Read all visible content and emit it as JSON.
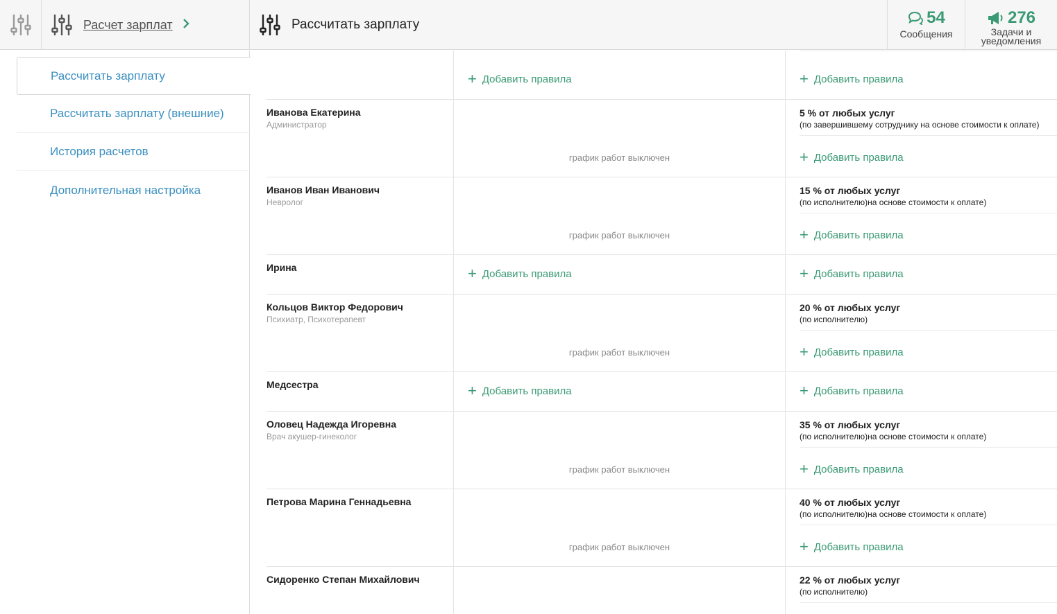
{
  "header": {
    "breadcrumb_link": "Расчет зарплат",
    "page_title": "Рассчитать зарплату",
    "messages": {
      "count": "54",
      "label": "Сообщения"
    },
    "tasks": {
      "count": "276",
      "label_line1": "Задачи и",
      "label_line2": "уведомления"
    }
  },
  "sidebar": {
    "items": [
      {
        "label": "Рассчитать зарплату"
      },
      {
        "label": "Рассчитать зарплату (внешние)"
      },
      {
        "label": "История расчетов"
      },
      {
        "label": "Дополнительная настройка"
      }
    ]
  },
  "table": {
    "add_rules_label": "Добавить правила",
    "schedule_off_label": "график работ выключен",
    "employees": [
      {
        "name": "Иванова Екатерина",
        "role": "Администратор",
        "rule": "5 % от любых услуг",
        "rule_desc": "(по завершившему сотруднику на основе стоимости к оплате)"
      },
      {
        "name": "Иванов Иван Иванович",
        "role": "Невролог",
        "rule": "15 % от любых услуг",
        "rule_desc": "(по исполнителю)на основе стоимости к оплате)"
      },
      {
        "name": "Ирина",
        "role": ""
      },
      {
        "name": "Кольцов Виктор Федорович",
        "role": "Психиатр, Психотерапевт",
        "rule": "20 % от любых услуг",
        "rule_desc": "(по исполнителю)"
      },
      {
        "name": "Медсестра",
        "role": ""
      },
      {
        "name": "Оловец Надежда Игоревна",
        "role": "Врач акушер-гинеколог",
        "rule": "35 % от любых услуг",
        "rule_desc": "(по исполнителю)на основе стоимости к оплате)"
      },
      {
        "name": "Петрова Марина Геннадьевна",
        "role": "",
        "rule": "40 % от любых услуг",
        "rule_desc": "(по исполнителю)на основе стоимости к оплате)"
      },
      {
        "name": "Сидоренко Степан Михайлович",
        "role": "",
        "rule": "22 % от любых услуг",
        "rule_desc": "(по исполнителю)"
      }
    ]
  }
}
